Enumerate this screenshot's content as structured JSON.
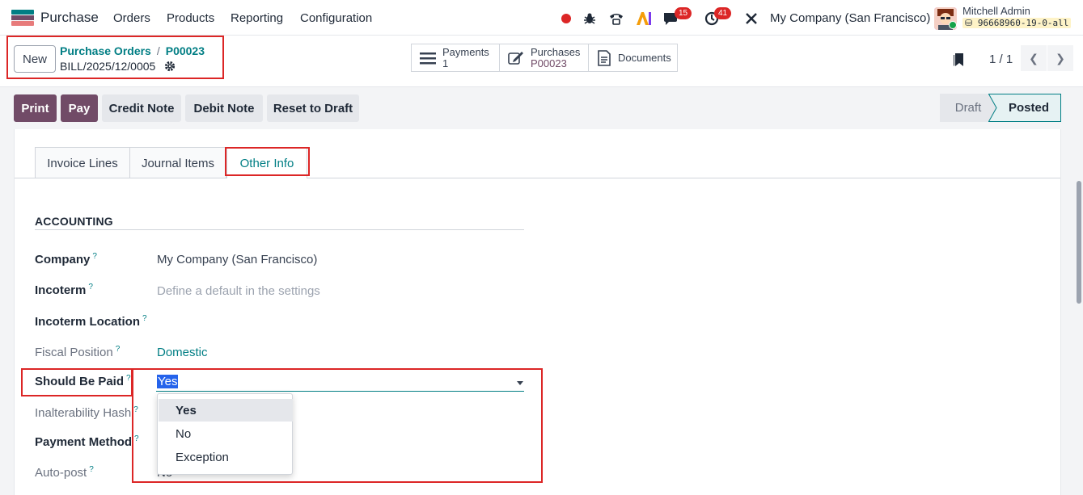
{
  "navbar": {
    "app_name": "Purchase",
    "menu": [
      "Orders",
      "Products",
      "Reporting",
      "Configuration"
    ],
    "chat_badge": "15",
    "activity_badge": "41",
    "company": "My Company (San Francisco)",
    "user_name": "Mitchell Admin",
    "database": "96668960-19-0-all"
  },
  "control": {
    "new_label": "New",
    "breadcrumb": [
      "Purchase Orders",
      "P00023"
    ],
    "record_name": "BILL/2025/12/0005",
    "smart_buttons": [
      {
        "label": "Payments",
        "value": "1"
      },
      {
        "label": "Purchases",
        "value": "P00023"
      },
      {
        "label": "Documents",
        "value": ""
      }
    ],
    "pager": "1 / 1"
  },
  "actions": [
    "Print",
    "Pay",
    "Credit Note",
    "Debit Note",
    "Reset to Draft"
  ],
  "status_bar": [
    "Draft",
    "Posted"
  ],
  "status_active": "Posted",
  "tabs": [
    "Invoice Lines",
    "Journal Items",
    "Other Info"
  ],
  "active_tab": "Other Info",
  "section_title": "ACCOUNTING",
  "fields": {
    "company": {
      "label": "Company",
      "value": "My Company (San Francisco)"
    },
    "incoterm": {
      "label": "Incoterm",
      "placeholder": "Define a default in the settings"
    },
    "incoterm_location": {
      "label": "Incoterm Location",
      "value": ""
    },
    "fiscal_position": {
      "label": "Fiscal Position",
      "value": "Domestic"
    },
    "should_be_paid": {
      "label": "Should Be Paid",
      "value": "Yes"
    },
    "inalterability_hash": {
      "label": "Inalterability Hash"
    },
    "payment_method": {
      "label": "Payment Method"
    },
    "auto_post": {
      "label": "Auto-post",
      "value": "No"
    }
  },
  "help_mark": "?",
  "dropdown_options": [
    "Yes",
    "No",
    "Exception"
  ],
  "colors": {
    "brand": "#714b67",
    "teal": "#017e84",
    "highlight": "#dc2626"
  }
}
